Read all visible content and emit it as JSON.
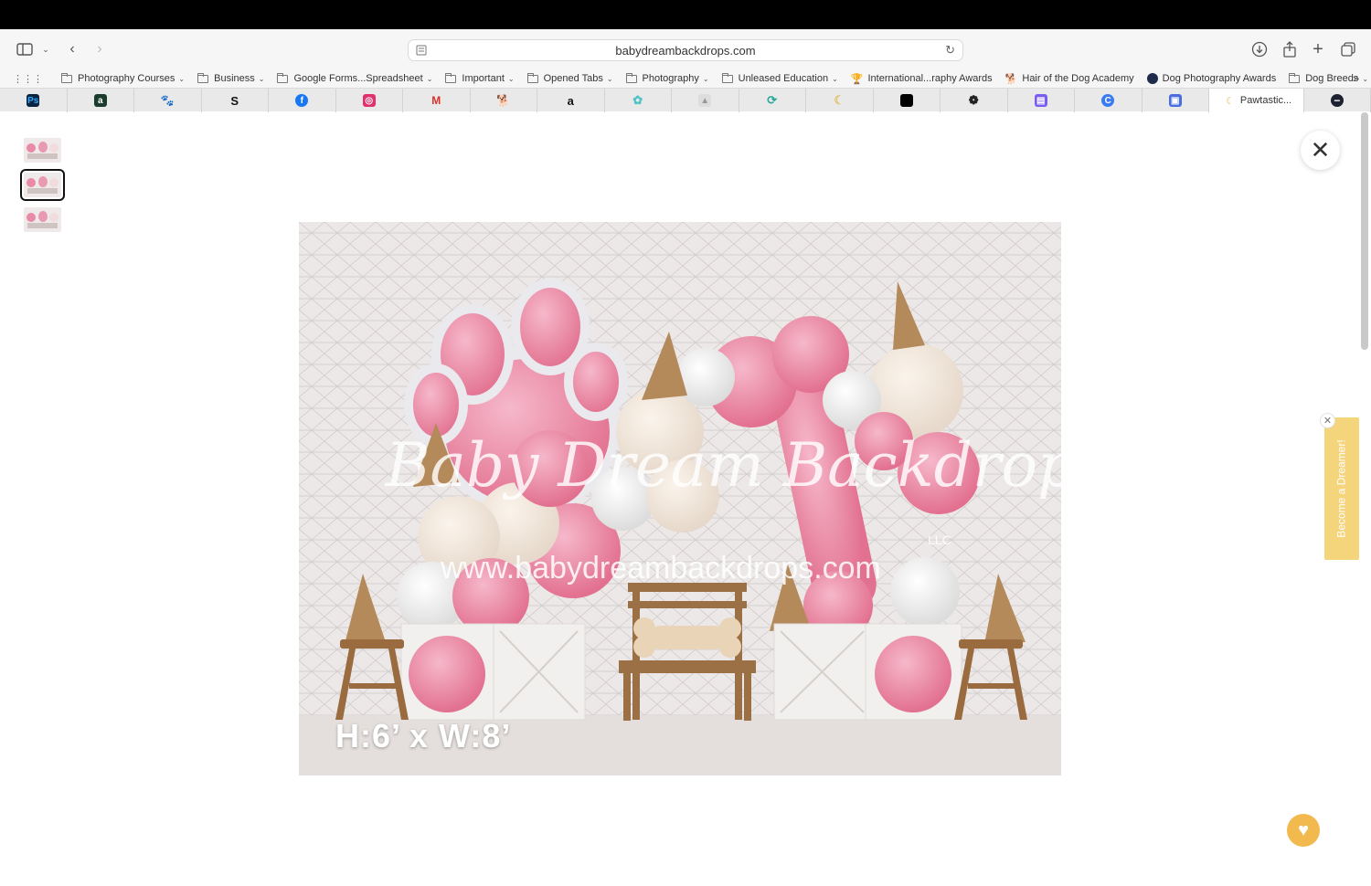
{
  "browser": {
    "url": "babydreambackdrops.com",
    "bookmarks": [
      {
        "label": "Photography Courses",
        "folder": true
      },
      {
        "label": "Business",
        "folder": true
      },
      {
        "label": "Google Forms...Spreadsheet",
        "folder": true
      },
      {
        "label": "Important",
        "folder": true
      },
      {
        "label": "Opened Tabs",
        "folder": true
      },
      {
        "label": "Photography",
        "folder": true
      },
      {
        "label": "Unleased Education",
        "folder": true
      },
      {
        "label": "International...raphy Awards",
        "folder": false
      },
      {
        "label": "Hair of the Dog Academy",
        "folder": false
      },
      {
        "label": "Dog Photography Awards",
        "folder": false
      },
      {
        "label": "Dog Breeds",
        "folder": true
      }
    ],
    "active_tab_label": "Pawtastic..."
  },
  "gallery": {
    "image_size_label": "H:6’ x W:8’",
    "watermark_text": "Baby Dream Backdrops",
    "watermark_suffix": "LLC",
    "watermark_url": "www.babydreambackdrops.com"
  },
  "promo": {
    "label": "Become a Dreamer!"
  },
  "colors": {
    "promo": "#f4d57b",
    "heart_button": "#f1b94e",
    "balloon_pink": "#e98aa7"
  }
}
